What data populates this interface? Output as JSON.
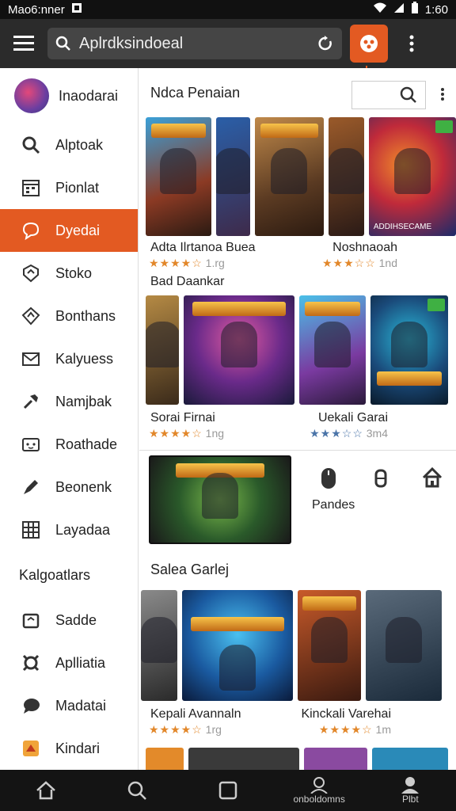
{
  "status": {
    "carrier": "Mao6:nner",
    "time": "1:60"
  },
  "toolbar": {
    "search_text": "Aplrdksindoeal"
  },
  "drawer": {
    "profile_name": "Inaodarai",
    "items": [
      {
        "label": "Alptoak",
        "icon": "search-icon"
      },
      {
        "label": "Pionlat",
        "icon": "calendar-icon"
      },
      {
        "label": "Dyedai",
        "icon": "chat-icon",
        "active": true
      },
      {
        "label": "Stoko",
        "icon": "shield-icon"
      },
      {
        "label": "Bonthans",
        "icon": "shield-up-icon"
      },
      {
        "label": "Kalyuess",
        "icon": "mail-icon"
      },
      {
        "label": "Namjbak",
        "icon": "wrench-icon"
      },
      {
        "label": "Roathade",
        "icon": "gamepad-icon"
      },
      {
        "label": "Beonenk",
        "icon": "pen-icon"
      },
      {
        "label": "Layadaa",
        "icon": "grid-icon"
      }
    ],
    "section": "Kalgoatlars",
    "section_items": [
      {
        "label": "Sadde",
        "icon": "store-icon"
      },
      {
        "label": "Aplliatia",
        "icon": "link-icon"
      },
      {
        "label": "Madatai",
        "icon": "bubble-icon"
      },
      {
        "label": "Kindari",
        "icon": "app-icon"
      }
    ]
  },
  "content": {
    "section1": "Ndca Penaian",
    "row1": [
      {
        "title": "Adta Ilrtanoa Buea",
        "rating": "1.rg",
        "stars": "★★★★☆"
      },
      {
        "title": "Noshnaoah",
        "rating": "1nd",
        "stars": "★★★☆☆"
      }
    ],
    "row1_card_text": "ADDIHSECAME",
    "sub1": "Bad Daankar",
    "row2": [
      {
        "title": "Sorai Firnai",
        "rating": "1ng",
        "stars": "★★★★☆"
      },
      {
        "title": "Uekali Garai",
        "rating": "3m4",
        "stars": "★★★☆☆"
      }
    ],
    "banner_label": "Pandes",
    "section2": "Salea Garlej",
    "row3": [
      {
        "title": "Kepali Avannaln",
        "rating": "1rg",
        "stars": "★★★★☆"
      },
      {
        "title": "Kinckali Varehai",
        "rating": "1m",
        "stars": "★★★★☆"
      }
    ]
  },
  "bottomnav": [
    {
      "label": "",
      "icon": "home-icon"
    },
    {
      "label": "",
      "icon": "search-icon"
    },
    {
      "label": "",
      "icon": "square-icon"
    },
    {
      "label": "onboldomns",
      "icon": "person-icon"
    },
    {
      "label": "Plbt",
      "icon": "profile-icon"
    }
  ],
  "colors": {
    "accent": "#e35a22",
    "toolbar": "#2b2b2b",
    "star": "#e2872a"
  }
}
